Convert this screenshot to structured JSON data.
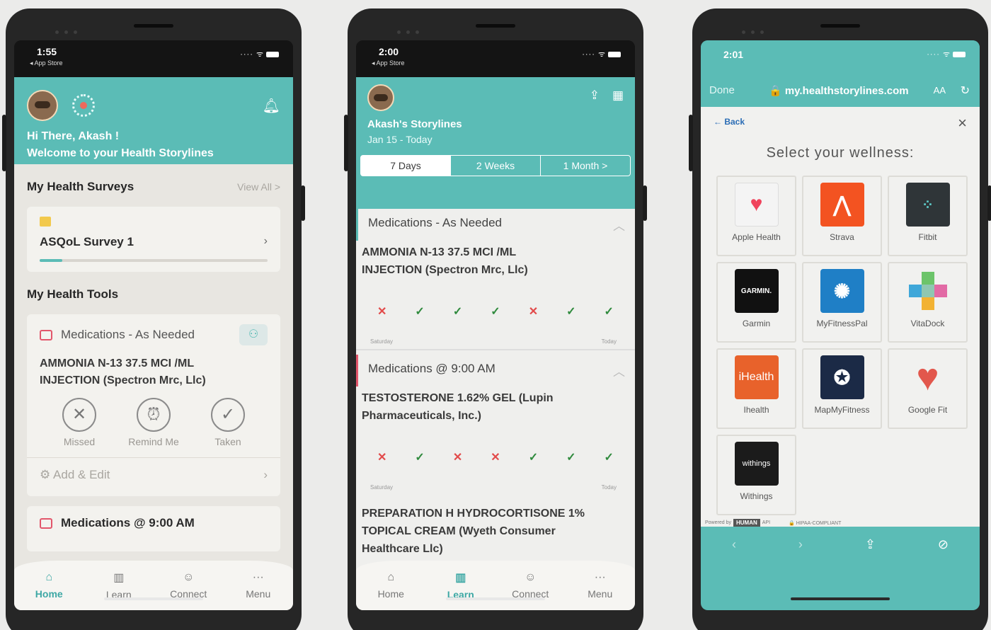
{
  "phone1": {
    "time": "1:55",
    "back_app": "◂ App Store",
    "greeting": "Hi There, Akash !",
    "welcome": "Welcome to your Health Storylines",
    "surveys": {
      "title": "My Health Surveys",
      "view_all": "View All >",
      "survey_name": "ASQoL Survey 1",
      "progress": 0.1
    },
    "tools_title": "My Health Tools",
    "med_section": "Medications - As Needed",
    "drug_line1": "AMMONIA N-13 37.5 MCI /ML",
    "drug_line2": "INJECTION (Spectron Mrc, Llc)",
    "actions": {
      "missed": "Missed",
      "remind": "Remind Me",
      "taken": "Taken"
    },
    "add_edit": "Add & Edit",
    "med_section2": "Medications @ 9:00 AM",
    "tabs": [
      "Home",
      "Learn",
      "Connect",
      "Menu"
    ]
  },
  "phone2": {
    "time": "2:00",
    "back_app": "◂ App Store",
    "title": "Akash's Storylines",
    "date_range": "Jan 15 - Today",
    "segments": [
      "7 Days",
      "2 Weeks",
      "1 Month >"
    ],
    "section1": "Medications - As Needed",
    "drug1_line1": "AMMONIA N-13 37.5 MCI /ML",
    "drug1_line2": "INJECTION (Spectron Mrc, Llc)",
    "section2": "Medications @ 9:00 AM",
    "drug2_line1": "TESTOSTERONE 1.62% GEL (Lupin",
    "drug2_line2": "Pharmaceuticals, Inc.)",
    "drug3_line1": "PREPARATION H HYDROCORTISONE 1%",
    "drug3_line2": "TOPICAL CREAM (Wyeth Consumer",
    "drug3_line3": "Healthcare Llc)",
    "axis_start": "Saturday",
    "axis_end": "Today",
    "tabs": [
      "Home",
      "Learn",
      "Connect",
      "Menu"
    ]
  },
  "phone3": {
    "time": "2:01",
    "done": "Done",
    "url": "🔒 my.healthstorylines.com",
    "aa": "AA",
    "back": "← Back",
    "heading": "Select your wellness:",
    "apps": [
      "Apple Health",
      "Strava",
      "Fitbit",
      "Garmin",
      "MyFitnessPal",
      "VitaDock",
      "Ihealth",
      "MapMyFitness",
      "Google Fit",
      "Withings"
    ],
    "garmin_logo": "GARMIN.",
    "ihealth_logo": "iHealth",
    "withings_logo": "withings",
    "powered_by": "Powered by",
    "human": "HUMAN",
    "api": "API",
    "hipaa": "🔒 HIPAA-COMPLIANT"
  }
}
